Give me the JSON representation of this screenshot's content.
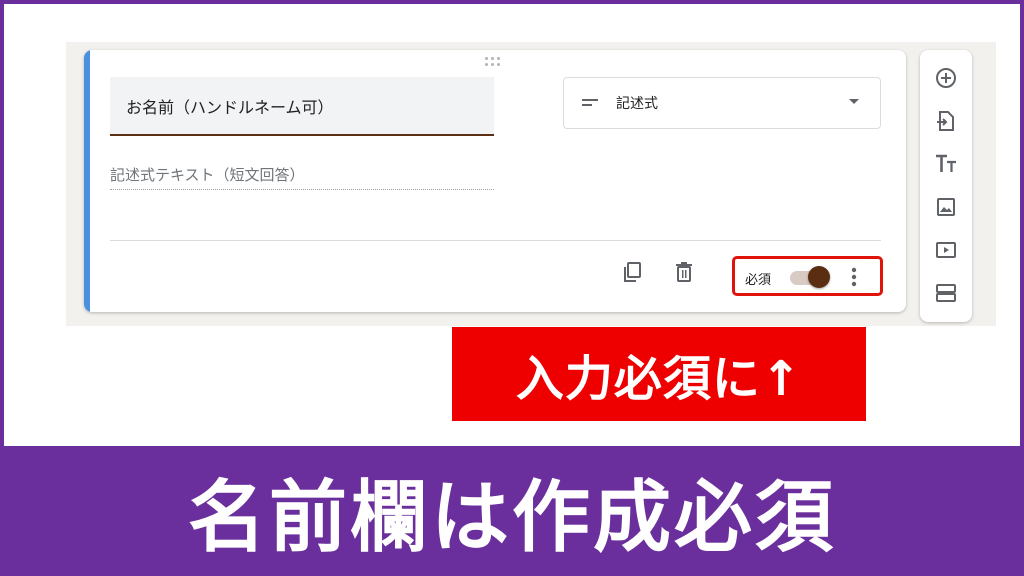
{
  "question_card": {
    "title_value": "お名前（ハンドルネーム可）",
    "type_select": {
      "selected": "記述式",
      "icon": "short-text-icon"
    },
    "answer_hint": "記述式テキスト（短文回答）",
    "required_label": "必須",
    "required_enabled": true,
    "accent_color": "#4a8fe0",
    "toggle_color": "#5b2e12"
  },
  "side_toolbar": {
    "tools": [
      "add-question-icon",
      "import-questions-icon",
      "add-title-icon",
      "add-image-icon",
      "add-video-icon",
      "add-section-icon"
    ]
  },
  "callout": {
    "text": "入力必須に↑",
    "color": "#ee0000"
  },
  "banner": {
    "text": "名前欄は作成必須",
    "color": "#6a2f9c"
  }
}
